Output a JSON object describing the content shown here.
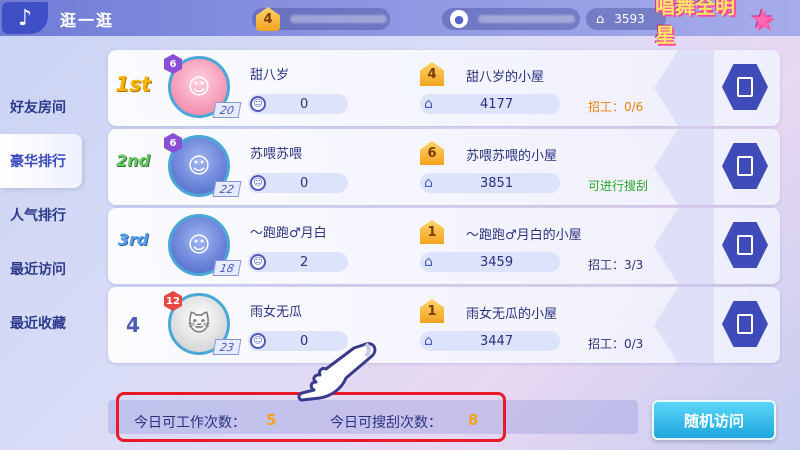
{
  "header": {
    "title": "逛一逛",
    "house_level": "4",
    "coins": "3593",
    "logo_text": "唱舞全明星"
  },
  "sidebar": {
    "tabs": [
      {
        "label": "好友房间",
        "active": false
      },
      {
        "label": "豪华排行",
        "active": true
      },
      {
        "label": "人气排行",
        "active": false
      },
      {
        "label": "最近访问",
        "active": false
      },
      {
        "label": "最近收藏",
        "active": false
      }
    ]
  },
  "rows": [
    {
      "rank": "1st",
      "level": "6",
      "age": "20",
      "name": "甜八岁",
      "likes": "0",
      "house_level": "4",
      "house_name": "甜八岁的小屋",
      "popularity": "4177",
      "status": "招工：0/6"
    },
    {
      "rank": "2nd",
      "level": "6",
      "age": "22",
      "name": "苏喂苏喂",
      "likes": "0",
      "house_level": "6",
      "house_name": "苏喂苏喂的小屋",
      "popularity": "3851",
      "status": "可进行搜刮"
    },
    {
      "rank": "3rd",
      "level": "6",
      "age": "18",
      "name": "～跑跑♂月白",
      "likes": "2",
      "house_level": "1",
      "house_name": "～跑跑♂月白的小屋",
      "popularity": "3459",
      "status": "招工：3/3"
    },
    {
      "rank": "4",
      "level": "12",
      "age": "23",
      "name": "雨女无瓜",
      "likes": "0",
      "house_level": "1",
      "house_name": "雨女无瓜的小屋",
      "popularity": "3447",
      "status": "招工：0/3"
    }
  ],
  "footer": {
    "work_label": "今日可工作次数：",
    "work_value": "5",
    "search_label": "今日可搜刮次数：",
    "search_value": "8",
    "random_button": "随机访问"
  }
}
